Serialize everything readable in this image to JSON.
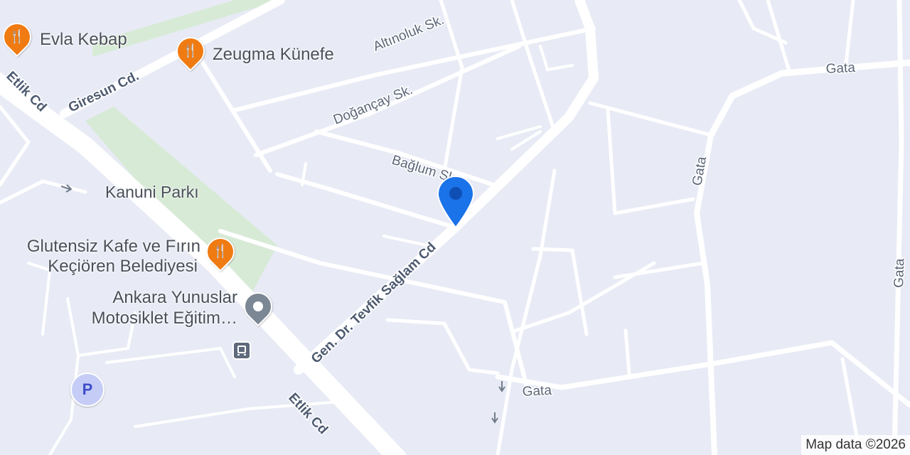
{
  "map": {
    "colors": {
      "background": "#e8ebf5",
      "road": "#ffffff",
      "park": "#d7ead6",
      "restaurant_pin": "#f07b12",
      "location_pin": "#1a73e8",
      "parking_badge": "#c5cdf7",
      "landmark_pin": "#7c8795"
    },
    "streets": {
      "altinoluk": "Altınoluk Sk.",
      "doganay": "Doğançay Sk.",
      "baglum": "Bağlum Sk.",
      "giresun": "Giresun Cd.",
      "etlik_top": "Etlik Cd",
      "etlik_bottom": "Etlik Cd",
      "tevfik": "Gen. Dr. Tevfik Sağlam Cd",
      "gata_top": "Gata",
      "gata_right_vertical": "Gata",
      "gata_far_right": "Gata",
      "gata_bottom": "Gata"
    },
    "places": {
      "evla_kebap": "Evla Kebap",
      "zeugma_kunefe": "Zeugma Künefe",
      "kanuni_parki": "Kanuni Parkı",
      "glutensiz_line1": "Glutensiz Kafe ve Fırın",
      "glutensiz_line2": "Keçiören Belediyesi",
      "yunuslar_line1": "Ankara Yunuslar",
      "yunuslar_line2": "Motosiklet Eğitim…"
    },
    "icons": {
      "restaurant": "fork-knife-icon",
      "landmark": "landmark-icon",
      "bus": "bus-stop-icon",
      "parking": "parking-icon",
      "location": "location-pin-icon"
    },
    "parking_label": "P",
    "attribution": "Map data ©2026"
  }
}
